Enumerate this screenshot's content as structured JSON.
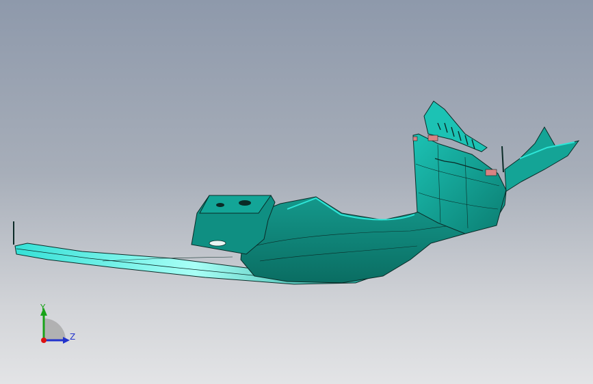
{
  "viewport": {
    "background_top": "#8e99ab",
    "background_bottom": "#e3e4e6"
  },
  "model": {
    "face_color": "#0f8f82",
    "highlight_color": "#2ee6d8",
    "edge_color": "#0a2a26",
    "tab_color": "#d98383"
  },
  "triad": {
    "y_label": "Y",
    "z_label": "Z",
    "y_color": "#19a319",
    "z_color": "#2233cc",
    "origin_color": "#dd1111"
  }
}
